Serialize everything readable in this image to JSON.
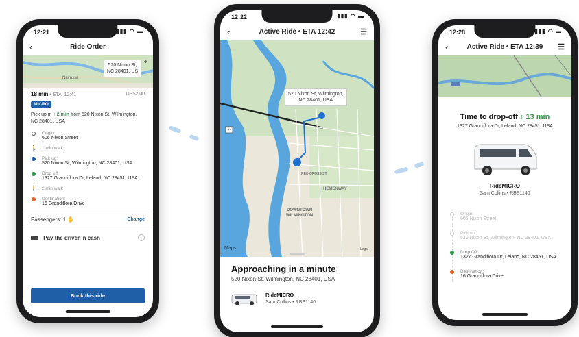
{
  "order_screen": {
    "status_time": "12:21",
    "title": "Ride Order",
    "map_label_street": "520 Nixon St,",
    "map_label_city": "NC 28401, US",
    "map_place": "Navassa",
    "duration": "18 min",
    "eta": "• ETA: 12:41",
    "price": "US$2.00",
    "service_badge": "MICRO",
    "pickup_prefix": "Pick up in",
    "pickup_minutes": "2 min",
    "pickup_from": "from 520 Nixon St, Wilmington, NC 28401, USA",
    "steps": [
      {
        "label": "Origin:",
        "value": "606 Nixon Street"
      },
      {
        "label": "",
        "value": "1 min walk"
      },
      {
        "label": "Pick up:",
        "value": "520 Nixon St, Wilmington, NC 28401, USA"
      },
      {
        "label": "Drop off:",
        "value": "1327 Grandiflora Dr, Leland, NC 28451, USA"
      },
      {
        "label": "",
        "value": "2 min walk"
      },
      {
        "label": "Destination:",
        "value": "16 Grandiflora Drive"
      }
    ],
    "passengers_label": "Passengers: 1",
    "change_label": "Change",
    "pay_cash_label": "Pay the driver in cash",
    "book_button": "Book this ride"
  },
  "active_screen": {
    "status_time": "12:22",
    "title": "Active Ride • ETA 12:42",
    "map_label_line1": "520 Nixon St, Wilmington,",
    "map_label_line2": "NC 28401, USA",
    "map_area_1": "DOWNTOWN",
    "map_area_2": "WILMINGTON",
    "map_area_3": "HEMENWAY",
    "map_street": "RED CROSS ST",
    "map_route_badge": "17",
    "maps_brand": "Maps",
    "legal": "Legal",
    "headline": "Approaching in a minute",
    "address": "520 Nixon St, Wilmington, NC 28401, USA",
    "vehicle_name": "RideMICRO",
    "driver": "Sam Collins • RBS1140"
  },
  "dropoff_screen": {
    "status_time": "12:28",
    "title": "Active Ride • ETA 12:39",
    "headline_prefix": "Time to drop-off",
    "headline_minutes": "13 min",
    "address": "1327 Grandiflora Dr, Leland, NC 28451, USA",
    "vehicle_name": "RideMICRO",
    "driver": "Sam Collins • RBS1140",
    "steps": [
      {
        "label": "Origin:",
        "value": "606 Nixon Street"
      },
      {
        "label": "Pick up:",
        "value": "520 Nixon St, Wilmington, NC 28401, USA"
      },
      {
        "label": "Drop Off:",
        "value": "1327 Grandiflora Dr, Leland, NC 28451, USA"
      },
      {
        "label": "Destination:",
        "value": "16 Grandiflora Drive"
      }
    ]
  },
  "colors": {
    "primary": "#1f5fa8",
    "green": "#2e9b46",
    "water": "#58a6dd",
    "route": "#1f6fd0"
  }
}
